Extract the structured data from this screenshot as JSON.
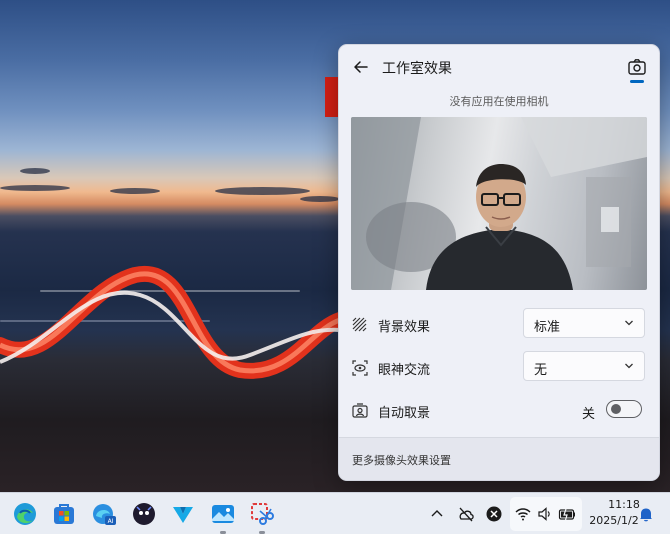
{
  "panel": {
    "title": "工作室效果",
    "status": "没有应用在使用相机",
    "effects": [
      {
        "label": "背景效果",
        "value": "标准",
        "icon": "background-effects-icon"
      },
      {
        "label": "眼神交流",
        "value": "无",
        "icon": "eye-contact-icon"
      },
      {
        "label": "自动取景",
        "toggle_state": "关",
        "icon": "automatic-framing-icon"
      }
    ],
    "footer_link": "更多摄像头效果设置"
  },
  "taskbar": {
    "apps": [
      "edge-icon",
      "microsoft-store-icon",
      "edge-ai-icon",
      "assistant-app-icon",
      "vector-app-icon",
      "photos-app-icon",
      "snipping-tool-icon"
    ],
    "tray": [
      "chevron-up-icon",
      "cloud-off-icon",
      "close-circle-icon",
      "wifi-icon",
      "volume-icon",
      "battery-icon",
      "notification-bell-icon"
    ],
    "time": "11:18",
    "date": "2025/1/2"
  },
  "colors": {
    "accent": "#0067c0",
    "warning_red": "#d41f14"
  }
}
